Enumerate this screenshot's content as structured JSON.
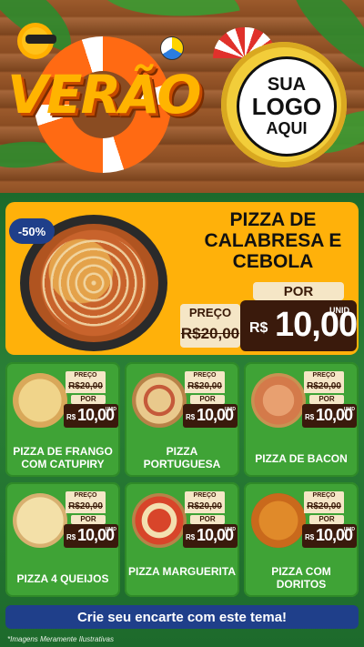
{
  "header": {
    "season_title": "VERÃO",
    "logo_lines": [
      "SUA",
      "LOGO",
      "AQUI"
    ]
  },
  "featured": {
    "discount": "-50%",
    "name": "PIZZA DE CALABRESA E CEBOLA",
    "price_label": "PREÇO",
    "old_price": "R$20,00",
    "por_label": "POR",
    "currency": "R$",
    "new_price": "10,00",
    "unit": "UNID"
  },
  "cards": [
    {
      "name": "PIZZA DE FRANGO COM CATUPIRY",
      "price_label": "PREÇO",
      "old_price": "R$20,00",
      "por_label": "POR",
      "currency": "R$",
      "new_price": "10,00",
      "unit": "UNID"
    },
    {
      "name": "PIZZA PORTUGUESA",
      "price_label": "PREÇO",
      "old_price": "R$20,00",
      "por_label": "POR",
      "currency": "R$",
      "new_price": "10,00",
      "unit": "UNID"
    },
    {
      "name": "PIZZA DE BACON",
      "price_label": "PREÇO",
      "old_price": "R$20,00",
      "por_label": "POR",
      "currency": "R$",
      "new_price": "10,00",
      "unit": "UNID"
    },
    {
      "name": "PIZZA 4 QUEIJOS",
      "price_label": "PREÇO",
      "old_price": "R$20,00",
      "por_label": "POR",
      "currency": "R$",
      "new_price": "10,00",
      "unit": "UNID"
    },
    {
      "name": "PIZZA MARGUERITA",
      "price_label": "PREÇO",
      "old_price": "R$20,00",
      "por_label": "POR",
      "currency": "R$",
      "new_price": "10,00",
      "unit": "UNID"
    },
    {
      "name": "PIZZA COM DORITOS",
      "price_label": "PREÇO",
      "old_price": "R$20,00",
      "por_label": "POR",
      "currency": "R$",
      "new_price": "10,00",
      "unit": "UNID"
    }
  ],
  "cta": {
    "label": "Crie seu encarte com este tema!"
  },
  "footnote": "*Imagens Meramente Ilustrativas",
  "colors": {
    "accent_yellow": "#ffb10a",
    "card_green": "#3fa336",
    "price_brown": "#3a1a0c",
    "cta_blue": "#1f3f8a"
  }
}
